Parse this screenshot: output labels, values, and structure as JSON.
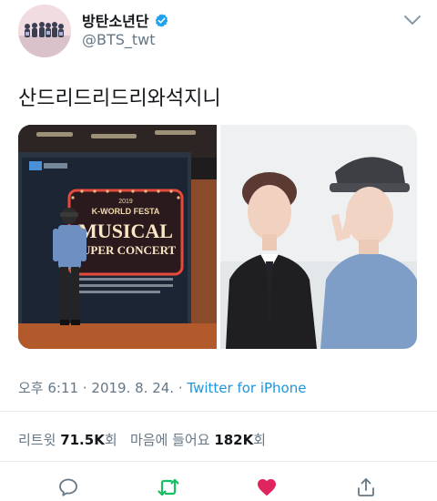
{
  "author": {
    "display_name": "방탄소년단",
    "handle": "@BTS_twt",
    "verified": true,
    "avatar_icon": "group-photo-avatar"
  },
  "tweet": {
    "text": "산드리드리드리와석지니",
    "poster_text": {
      "year": "2019",
      "event": "K-WORLD FESTA",
      "title_line1": "MUSICAL",
      "title_line2": "SUPER CONCERT"
    }
  },
  "meta": {
    "time": "오후 6:11",
    "sep1": "·",
    "date": "2019. 8. 24.",
    "sep2": "·",
    "source": "Twitter for iPhone"
  },
  "stats": {
    "retweet_label": "리트윗",
    "retweet_count": "71.5K",
    "retweet_suffix": "회",
    "like_label": "마음에 들어요",
    "like_count": "182K",
    "like_suffix": "회"
  },
  "actions": {
    "reply_icon": "reply-icon",
    "retweet_icon": "retweet-icon",
    "like_icon": "heart-icon",
    "share_icon": "share-icon"
  },
  "colors": {
    "link": "#1b95e0",
    "retweet": "#17bf63",
    "like": "#e0245e",
    "muted": "#657786"
  }
}
